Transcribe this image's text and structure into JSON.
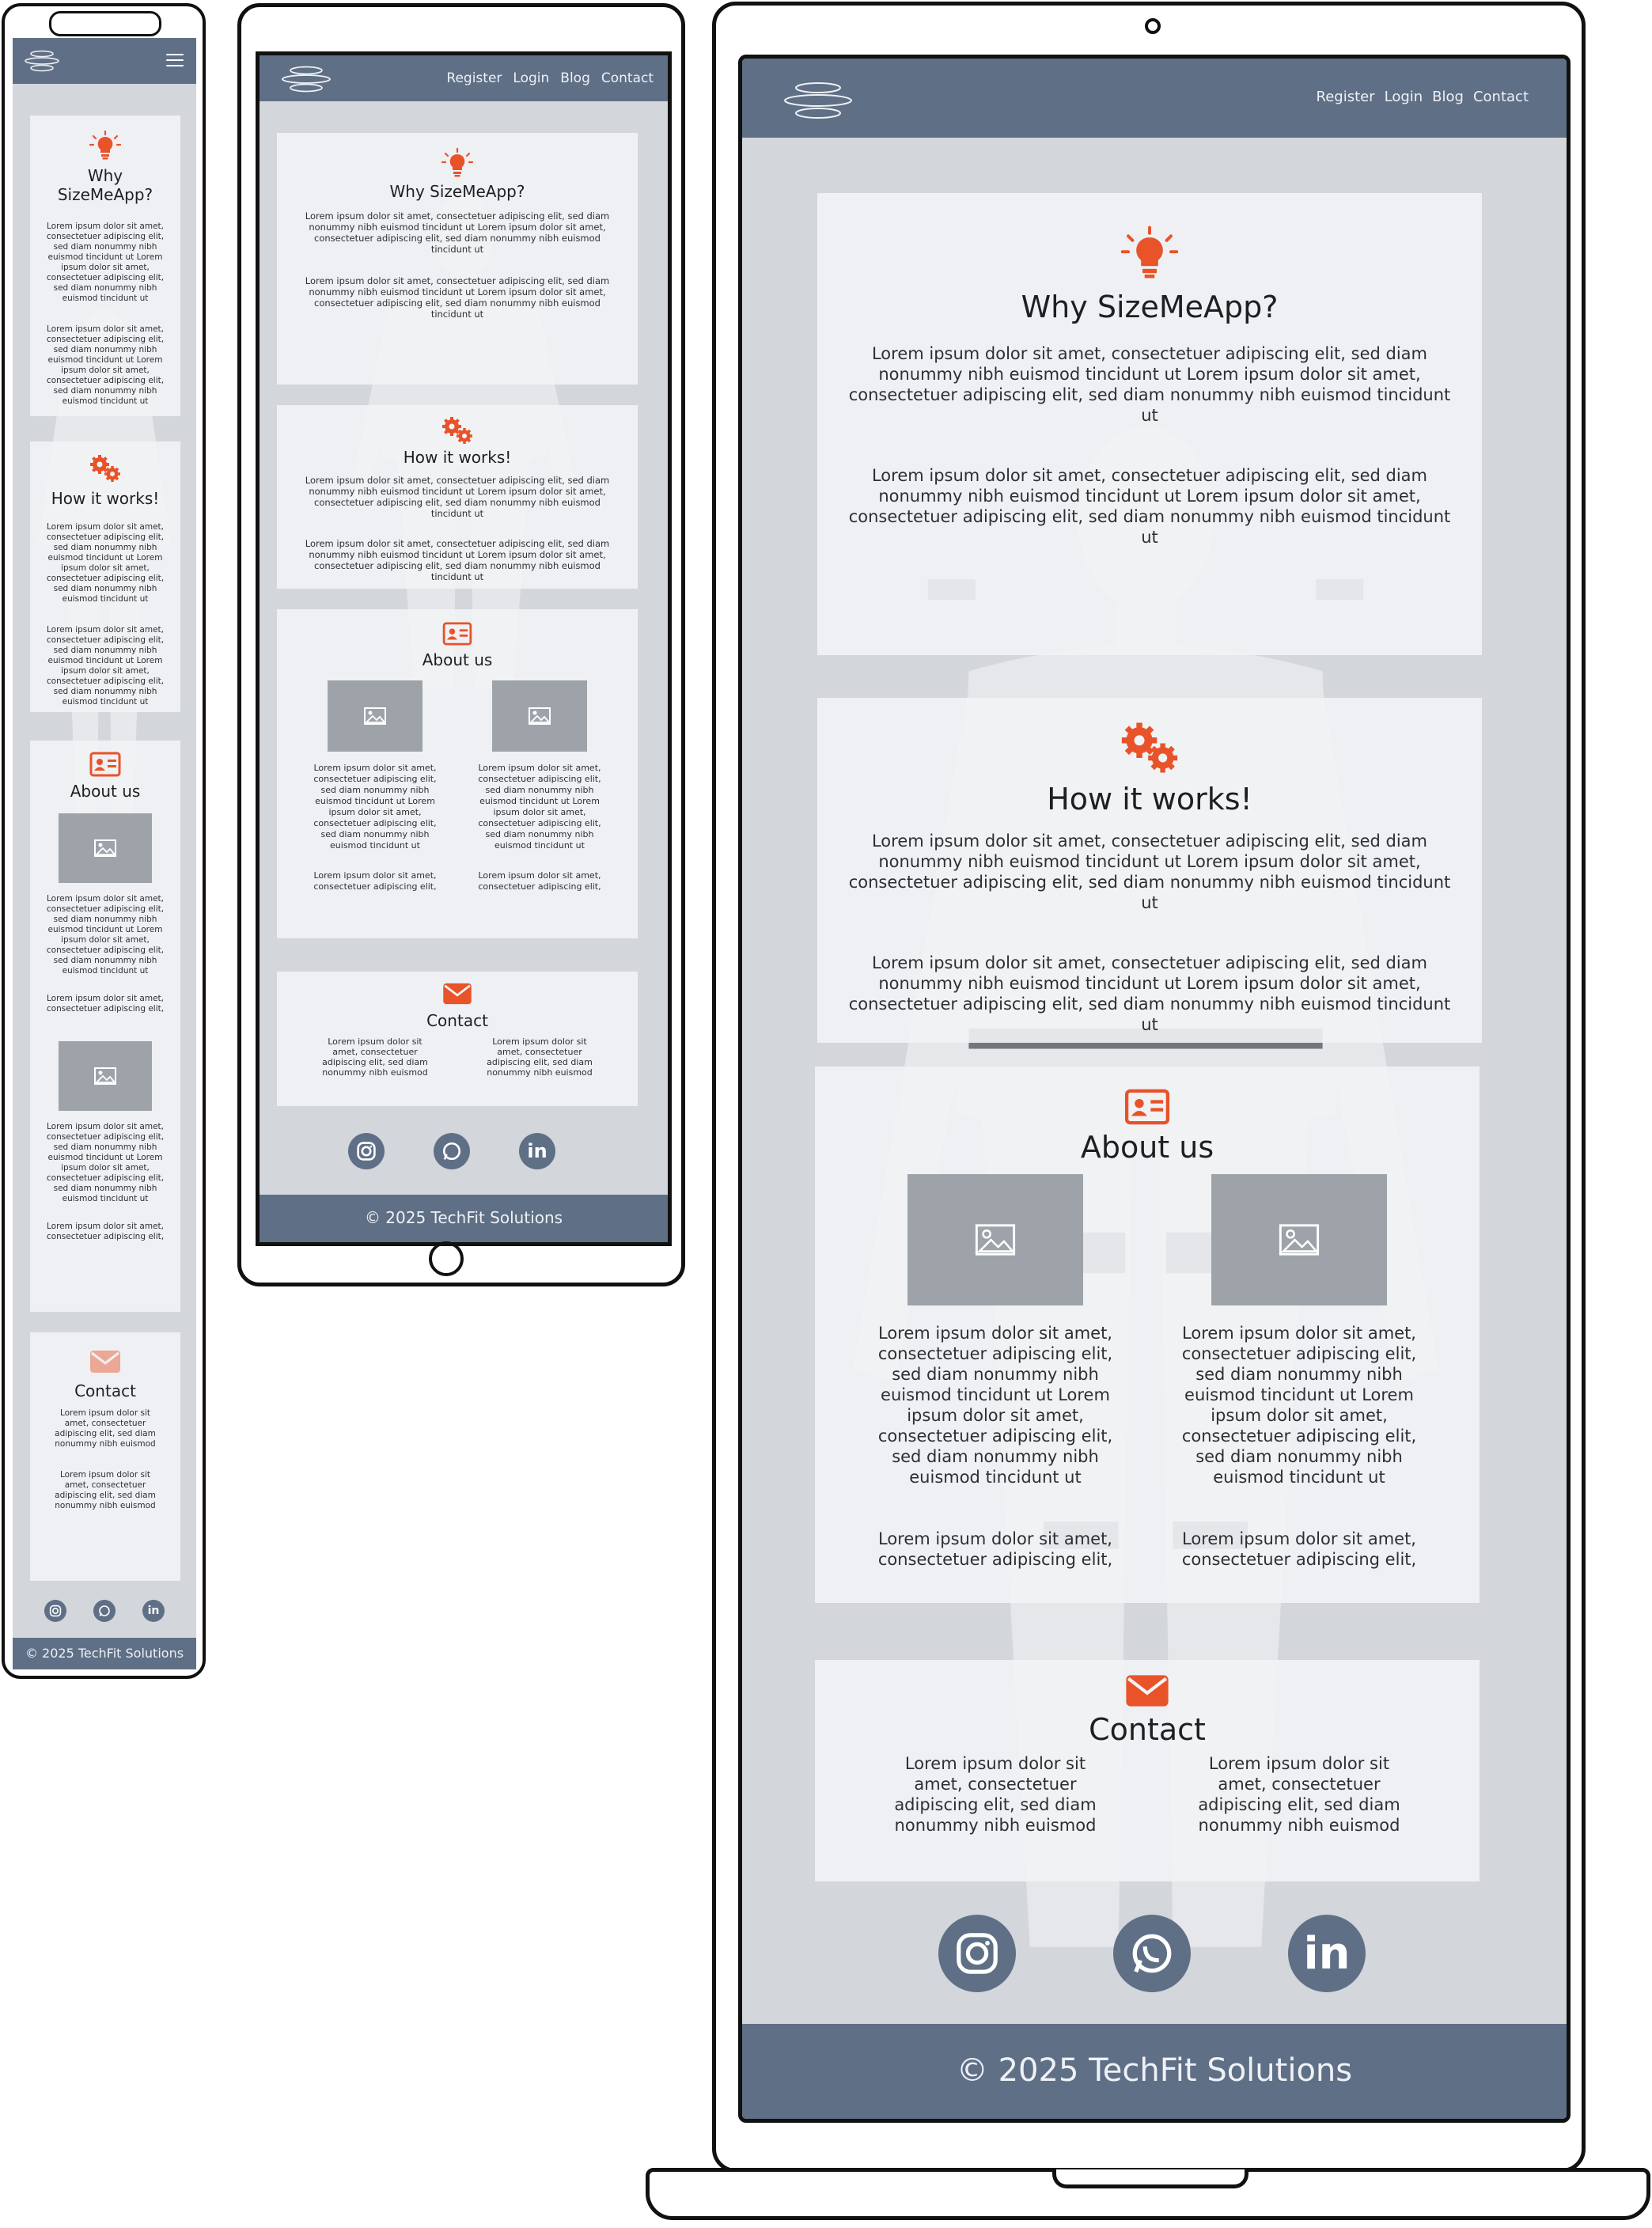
{
  "nav": {
    "items": [
      "Register",
      "Login",
      "Blog",
      "Contact"
    ]
  },
  "sections": {
    "why": {
      "title": "Why SizeMeApp?",
      "paragraphs": [
        "Lorem ipsum dolor sit amet, consectetuer adipiscing elit, sed diam nonummy nibh euismod tincidunt ut Lorem ipsum dolor sit amet, consectetuer adipiscing elit, sed diam nonummy nibh euismod tincidunt ut",
        "Lorem ipsum dolor sit amet, consectetuer adipiscing elit, sed diam nonummy nibh euismod tincidunt ut Lorem ipsum dolor sit amet, consectetuer adipiscing elit, sed diam nonummy nibh euismod tincidunt ut"
      ]
    },
    "how": {
      "title": "How it works!",
      "paragraphs": [
        "Lorem ipsum dolor sit amet, consectetuer adipiscing elit, sed diam nonummy nibh euismod tincidunt ut Lorem ipsum dolor sit amet, consectetuer adipiscing elit, sed diam nonummy nibh euismod tincidunt ut",
        "Lorem ipsum dolor sit amet, consectetuer adipiscing elit, sed diam nonummy nibh euismod tincidunt ut Lorem ipsum dolor sit amet, consectetuer adipiscing elit, sed diam nonummy nibh euismod tincidunt ut"
      ]
    },
    "about": {
      "title": "About us",
      "members": [
        {
          "text": "Lorem ipsum dolor sit amet, consectetuer adipiscing elit, sed diam nonummy nibh euismod tincidunt ut Lorem ipsum dolor sit amet, consectetuer adipiscing elit, sed diam nonummy nibh euismod tincidunt ut",
          "extra": "Lorem ipsum dolor sit amet, consectetuer adipiscing elit,"
        },
        {
          "text": "Lorem ipsum dolor sit amet, consectetuer adipiscing elit, sed diam nonummy nibh euismod tincidunt ut Lorem ipsum dolor sit amet, consectetuer adipiscing elit, sed diam nonummy nibh euismod tincidunt ut",
          "extra": "Lorem ipsum dolor sit amet, consectetuer adipiscing elit,"
        }
      ]
    },
    "contact": {
      "title": "Contact",
      "columns": [
        "Lorem ipsum dolor sit amet, consectetuer adipiscing elit, sed diam nonummy nibh euismod",
        "Lorem ipsum dolor sit amet, consectetuer adipiscing elit, sed diam nonummy nibh euismod"
      ]
    }
  },
  "social": {
    "icons": [
      "instagram-icon",
      "whatsapp-icon",
      "linkedin-icon"
    ],
    "linkedin_label": "in"
  },
  "footer": {
    "text": "© 2025  TechFit Solutions"
  },
  "colors": {
    "nav_bar": "#5f6f86",
    "page_bg": "#d3d6db",
    "card_bg": "#f2f3f5",
    "accent": "#e8532a",
    "image_placeholder": "#9ea3aa"
  }
}
